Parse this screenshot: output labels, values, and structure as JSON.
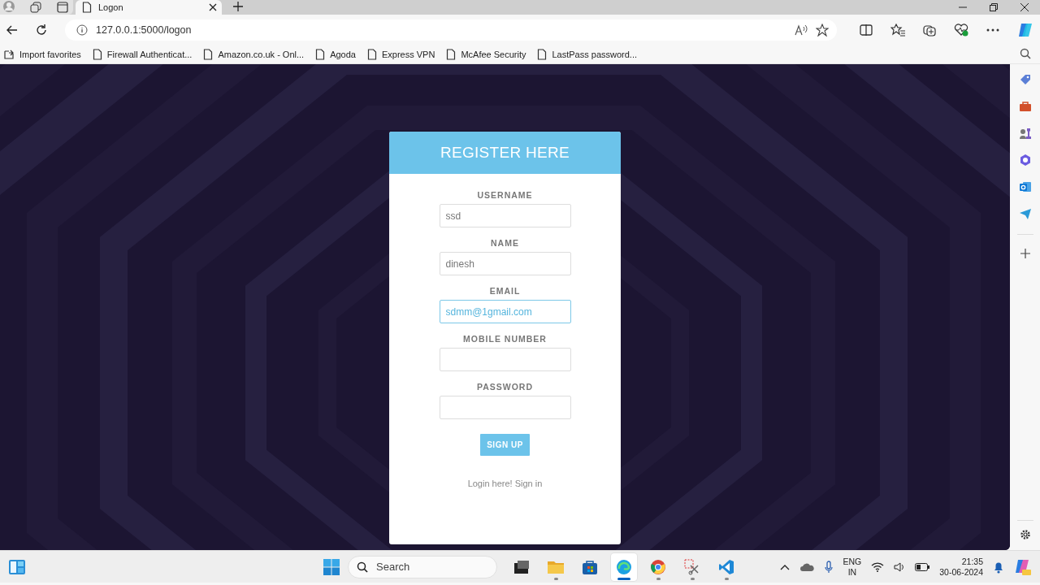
{
  "browser": {
    "tab": {
      "title": "Logon"
    },
    "url": "127.0.0.1:5000/logon",
    "bookmarks": [
      {
        "label": "Import favorites",
        "kind": "import"
      },
      {
        "label": "Firewall Authenticat...",
        "kind": "page"
      },
      {
        "label": "Amazon.co.uk - Onl...",
        "kind": "page"
      },
      {
        "label": "Agoda",
        "kind": "page"
      },
      {
        "label": "Express VPN",
        "kind": "page"
      },
      {
        "label": "McAfee Security",
        "kind": "page"
      },
      {
        "label": "LastPass password...",
        "kind": "page"
      }
    ]
  },
  "form": {
    "title": "REGISTER HERE",
    "fields": [
      {
        "label": "USERNAME",
        "value": "ssd",
        "focused": false,
        "kind": "text"
      },
      {
        "label": "NAME",
        "value": "dinesh",
        "focused": false,
        "kind": "text"
      },
      {
        "label": "EMAIL",
        "value": "sdmm@1gmail.com",
        "focused": true,
        "kind": "text"
      },
      {
        "label": "MOBILE NUMBER",
        "focused": false,
        "kind": "text"
      },
      {
        "label": "PASSWORD",
        "focused": false,
        "kind": "password"
      }
    ],
    "submit": "SIGN UP",
    "footer": "Login here! Sign in"
  },
  "taskbar": {
    "search": {
      "placeholder": "Search"
    },
    "apps": [
      {
        "kind": "files-dark",
        "running": false,
        "selected": false
      },
      {
        "kind": "folder",
        "running": true,
        "selected": false
      },
      {
        "kind": "store",
        "running": false,
        "selected": false
      },
      {
        "kind": "edge",
        "running": true,
        "selected": true
      },
      {
        "kind": "chrome",
        "running": true,
        "selected": false
      },
      {
        "kind": "snip",
        "running": true,
        "selected": false
      },
      {
        "kind": "code",
        "running": true,
        "selected": false
      }
    ],
    "language": [
      "ENG",
      "IN"
    ],
    "time": "21:35",
    "date": "30-06-2024"
  }
}
